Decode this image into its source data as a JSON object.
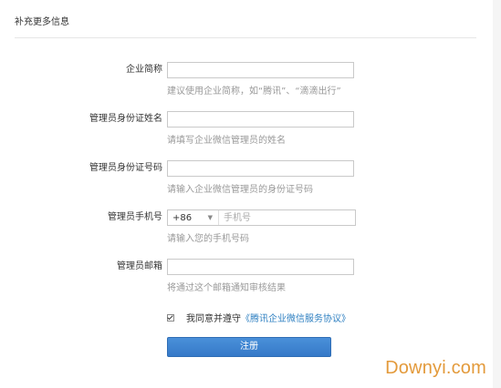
{
  "section": {
    "title": "补充更多信息"
  },
  "fields": {
    "company_short": {
      "label": "企业简称",
      "value": "",
      "placeholder": "",
      "hint": "建议使用企业简称，如“腾讯”、“滴滴出行”"
    },
    "admin_name": {
      "label": "管理员身份证姓名",
      "value": "",
      "placeholder": "",
      "hint": "请填写企业微信管理员的姓名"
    },
    "admin_id": {
      "label": "管理员身份证号码",
      "value": "",
      "placeholder": "",
      "hint": "请输入企业微信管理员的身份证号码"
    },
    "admin_phone": {
      "label": "管理员手机号",
      "country_code": "+86",
      "value": "",
      "placeholder": "手机号",
      "hint": "请输入您的手机号码"
    },
    "admin_email": {
      "label": "管理员邮箱",
      "value": "",
      "placeholder": "",
      "hint": "将通过这个邮箱通知审核结果"
    }
  },
  "agreement": {
    "checked": true,
    "text": "我同意并遵守",
    "link": "《腾讯企业微信服务协议》"
  },
  "submit_label": "注册",
  "watermark": "Downyi.com"
}
